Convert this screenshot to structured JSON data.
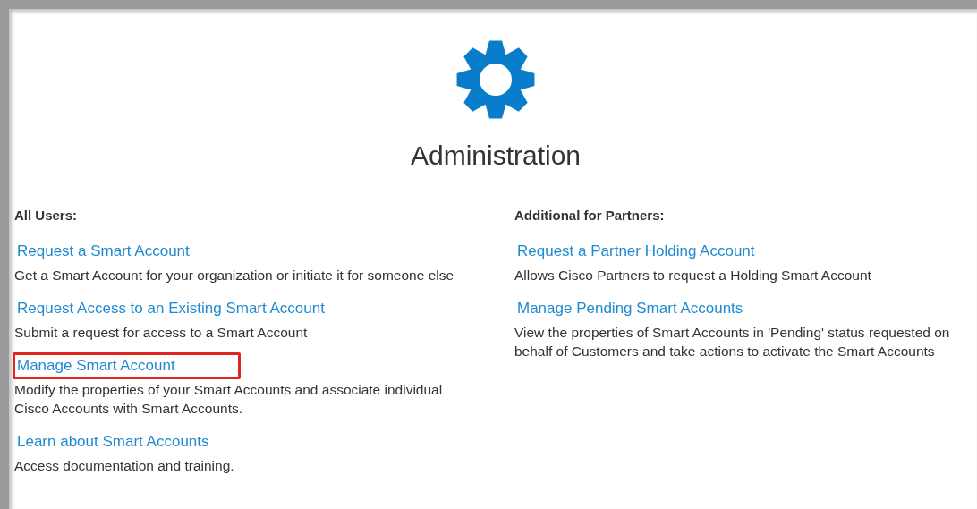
{
  "title": "Administration",
  "columns": [
    {
      "heading": "All Users:",
      "items": [
        {
          "link": "Request a Smart Account",
          "description": "Get a Smart Account for your organization or initiate it for someone else",
          "highlighted": false
        },
        {
          "link": "Request Access to an Existing Smart Account",
          "description": "Submit a request for access to a Smart Account",
          "highlighted": false
        },
        {
          "link": "Manage Smart Account",
          "description": "Modify the properties of your Smart Accounts and associate individual Cisco Accounts with Smart Accounts.",
          "highlighted": true
        },
        {
          "link": "Learn about Smart Accounts",
          "description": "Access documentation and training.",
          "highlighted": false
        }
      ]
    },
    {
      "heading": "Additional for Partners:",
      "items": [
        {
          "link": "Request a Partner Holding Account",
          "description": "Allows Cisco Partners to request a Holding Smart Account",
          "highlighted": false
        },
        {
          "link": "Manage Pending Smart Accounts",
          "description": "View the properties of Smart Accounts in 'Pending' status requested on behalf of Customers and take actions to activate the Smart Accounts",
          "highlighted": false
        }
      ]
    }
  ]
}
